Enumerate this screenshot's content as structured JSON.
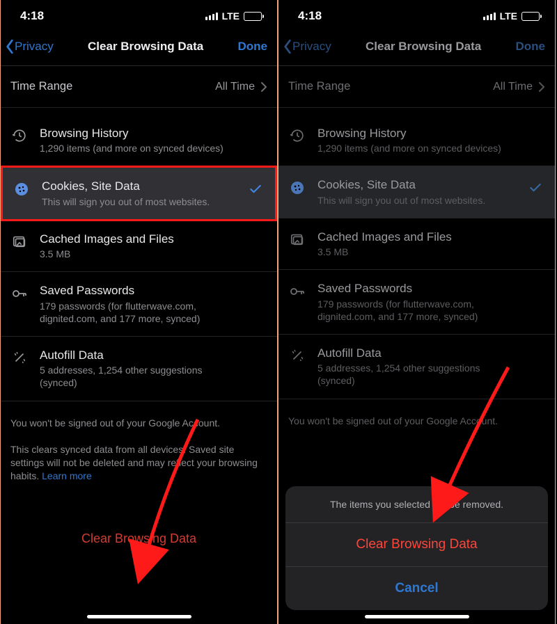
{
  "statusbar": {
    "time": "4:18",
    "network": "LTE"
  },
  "nav": {
    "back": "Privacy",
    "title": "Clear Browsing Data",
    "done": "Done"
  },
  "timeRange": {
    "label": "Time Range",
    "value": "All Time"
  },
  "items": {
    "history": {
      "title": "Browsing History",
      "sub": "1,290 items (and more on synced devices)"
    },
    "cookies": {
      "title": "Cookies, Site Data",
      "sub": "This will sign you out of most websites."
    },
    "cache": {
      "title": "Cached Images and Files",
      "sub": "3.5 MB"
    },
    "passwords": {
      "title": "Saved Passwords",
      "sub": "179 passwords (for flutterwave.com, dignited.com, and 177 more, synced)"
    },
    "autofill": {
      "title": "Autofill Data",
      "sub": "5 addresses, 1,254 other suggestions (synced)"
    }
  },
  "footnote1": "You won't be signed out of your Google Account.",
  "footnote2": "This clears synced data from all devices. Saved site settings will not be deleted and may reflect your browsing habits. ",
  "learnMore": "Learn more",
  "clearButton": "Clear Browsing Data",
  "sheet": {
    "message": "The items you selected will be removed.",
    "confirm": "Clear Browsing Data",
    "cancel": "Cancel"
  },
  "colors": {
    "accent": "#2e78d2",
    "danger": "#ff453a",
    "highlight": "#ff1a1a"
  }
}
